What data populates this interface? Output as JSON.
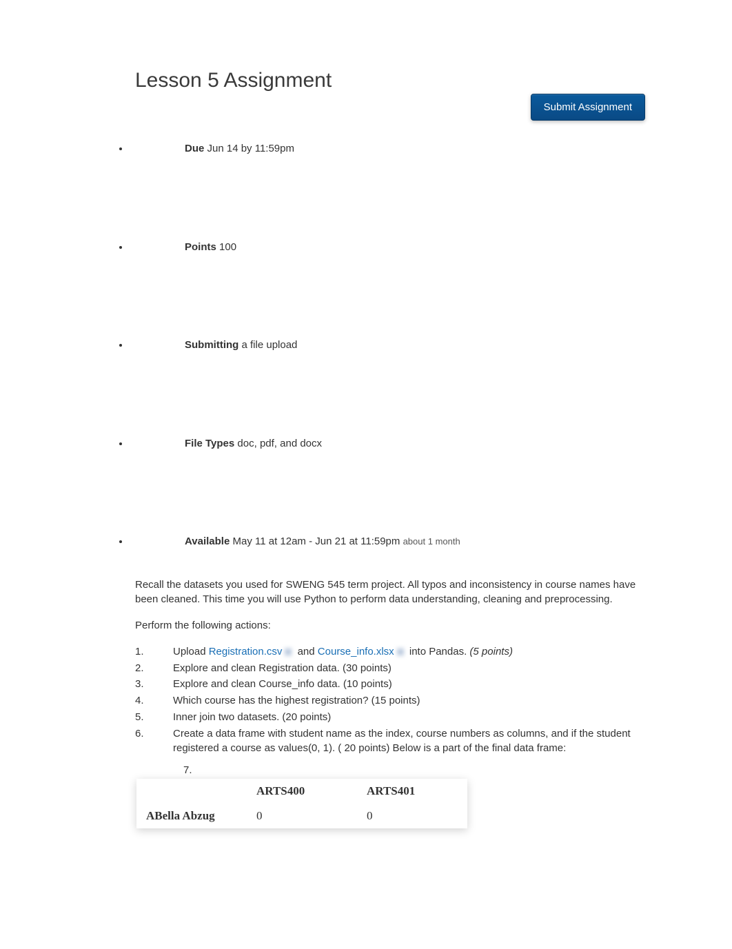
{
  "title": "Lesson 5 Assignment",
  "submit_label": "Submit Assignment",
  "meta": {
    "due_label": "Due",
    "due_value": "Jun 14 by 11:59pm",
    "points_label": "Points",
    "points_value": "100",
    "submitting_label": "Submitting",
    "submitting_value": "a file upload",
    "filetypes_label": "File Types",
    "filetypes_value": "doc, pdf, and docx",
    "available_label": "Available",
    "available_value": "May 11 at 12am - Jun 21 at 11:59pm",
    "available_duration": "about 1 month"
  },
  "body": {
    "intro": "Recall the datasets you used for SWENG 545 term project. All typos and inconsistency in course names have been cleaned. This time you will use Python to perform data understanding, cleaning and preprocessing.",
    "perform": "Perform the following actions:",
    "items": {
      "n1": "1.",
      "n2": "2.",
      "n3": "3.",
      "n4": "4.",
      "n5": "5.",
      "n6": "6.",
      "n7": "7.",
      "i1_pre": "Upload ",
      "i1_link1": "Registration.csv",
      "i1_mid": " and ",
      "i1_link2": "Course_info.xlsx",
      "i1_post": " into Pandas. ",
      "i1_pts": "(5 points)",
      "i2": "Explore and clean Registration data. (30 points)",
      "i3": "Explore and clean Course_info data. (10 points)",
      "i4": "Which course has the highest registration? (15 points)",
      "i5": "Inner join two datasets. (20 points)",
      "i6": "Create a data frame with student name as the index, course numbers as columns, and if the student registered a course as values(0, 1). ( 20 points) Below is a part of the final data frame:"
    }
  },
  "table": {
    "col1": "ARTS400",
    "col2": "ARTS401",
    "row1_name": "ABella Abzug",
    "row1_v1": "0",
    "row1_v2": "0"
  }
}
